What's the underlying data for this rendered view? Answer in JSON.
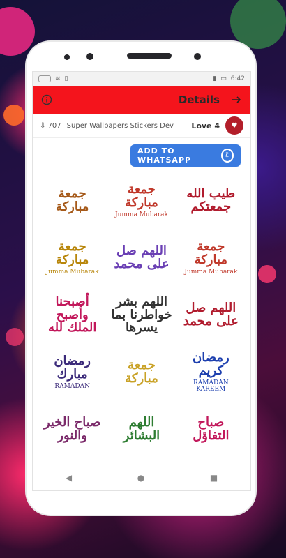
{
  "status_bar": {
    "time": "6:42"
  },
  "app_bar": {
    "title": "Details",
    "info_icon": "info-icon",
    "next_icon": "arrow-right-icon"
  },
  "pack": {
    "count": "707",
    "developer": "Super Wallpapers Stickers Dev",
    "name": "Love 4"
  },
  "whatsapp_button": {
    "label": "ADD TO WHATSAPP",
    "icon": "whatsapp-icon",
    "color": "#3a7be0"
  },
  "stickers": [
    {
      "main": "جمعة مباركة",
      "sub": "",
      "color": "#a65a1a"
    },
    {
      "main": "جمعة مباركة",
      "sub": "Jumma Mubarak",
      "color": "#c0392b"
    },
    {
      "main": "طيب الله جمعتكم",
      "sub": "",
      "color": "#b11c2e"
    },
    {
      "main": "جمعة مباركة",
      "sub": "Jumma Mubarak",
      "color": "#b8860b"
    },
    {
      "main": "اللهم صل على محمد",
      "sub": "",
      "color": "#6a3fb4"
    },
    {
      "main": "جمعة مباركة",
      "sub": "Jumma Mubarak",
      "color": "#c0392b"
    },
    {
      "main": "أصبحنا وأصبح الملك لله",
      "sub": "",
      "color": "#c2185b"
    },
    {
      "main": "اللهم بشر خواطرنا بما يسرها",
      "sub": "",
      "color": "#333333"
    },
    {
      "main": "اللهم صل على محمد",
      "sub": "",
      "color": "#b11c2e"
    },
    {
      "main": "رمضان مبارك",
      "sub": "RAMADAN",
      "color": "#3b2a7a"
    },
    {
      "main": "جمعة مباركة",
      "sub": "",
      "color": "#c9a227"
    },
    {
      "main": "رمضان كريم",
      "sub": "RAMADAN KAREEM",
      "color": "#1e40af"
    },
    {
      "main": "صباح الخير والنور",
      "sub": "",
      "color": "#7b2a6a"
    },
    {
      "main": "اللهم البشائر",
      "sub": "",
      "color": "#2e7d32"
    },
    {
      "main": "صباح التفاؤل",
      "sub": "",
      "color": "#c2185b"
    }
  ],
  "nav": {
    "back": "◀",
    "home": "●",
    "recents": "■"
  },
  "colors": {
    "app_bar": "#f4141c",
    "screen_bg": "#ffffff"
  }
}
